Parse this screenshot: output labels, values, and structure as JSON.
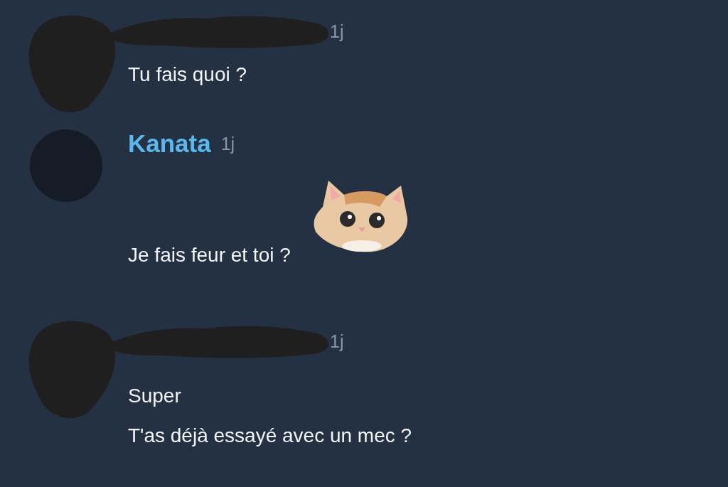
{
  "messages": [
    {
      "author": {
        "kind": "redacted"
      },
      "time": "1j",
      "lines": [
        {
          "kind": "text",
          "text": "Tu fais quoi ?"
        }
      ]
    },
    {
      "author": {
        "kind": "named",
        "name": "Kanata"
      },
      "time": "1j",
      "lines": [
        {
          "kind": "text_with_sticker",
          "text": "Je fais feur et toi ?"
        }
      ]
    },
    {
      "author": {
        "kind": "redacted"
      },
      "time": "1j",
      "lines": [
        {
          "kind": "text",
          "text": "Super"
        },
        {
          "kind": "text",
          "text": "T'as déjà essayé avec un mec ?"
        }
      ]
    }
  ]
}
